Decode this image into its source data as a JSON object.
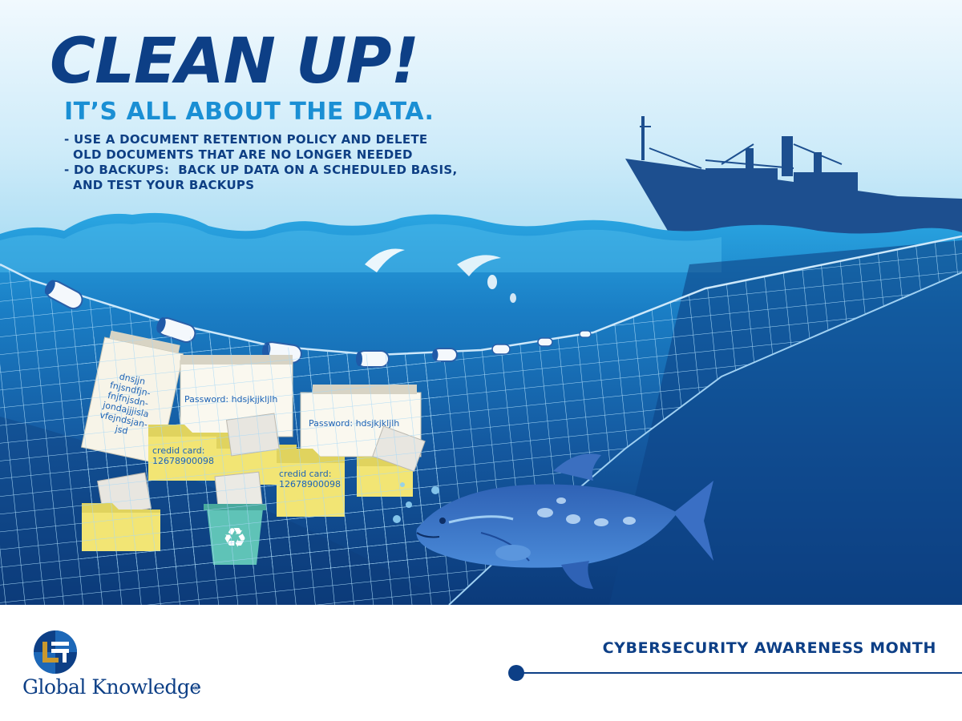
{
  "poster": {
    "heading": "CLEAN UP!",
    "subheading": "IT’S ALL ABOUT THE DATA.",
    "tips": [
      "- USE A DOCUMENT RETENTION POLICY AND DELETE",
      "  OLD DOCUMENTS THAT ARE NO LONGER NEEDED",
      "- DO BACKUPS:  BACK UP DATA ON A SCHEDULED BASIS,",
      "  AND TEST YOUR BACKUPS"
    ]
  },
  "illustration": {
    "note_scribble": "dnsjjn\nfnjsndfjn-\nfnjfnjsdn-\njondajjjisla\nvfejndsjan-\njsd",
    "password_1": "Password: hdsjkjjkljlh",
    "password_2": "Password: hdsjkjkljlh",
    "card_1": "credid card:\n12678900098",
    "card_2": "credid card:\n12678900098"
  },
  "footer": {
    "brand": "Global Knowledge",
    "brand_mark": "®",
    "campaign": "CYBERSECURITY AWARENESS MONTH"
  },
  "colors": {
    "heading": "#0d3f86",
    "subheading": "#1a8fd4",
    "sky_light": "#e9f5fc",
    "sea_top": "#2ba4e0",
    "sea_deep": "#0b3c7c",
    "ship": "#1d4f8f",
    "folder_yellow": "#f2e574",
    "fish": "#3c78c8",
    "brand_gold": "#c9982e"
  }
}
